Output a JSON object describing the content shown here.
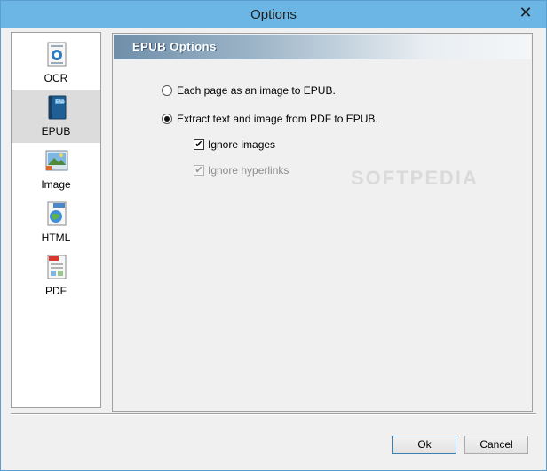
{
  "window": {
    "title": "Options",
    "close": "✕"
  },
  "nav": {
    "items": [
      {
        "label": "OCR",
        "icon": "ocr-icon"
      },
      {
        "label": "EPUB",
        "icon": "epub-book-icon",
        "selected": true
      },
      {
        "label": "Image",
        "icon": "image-icon"
      },
      {
        "label": "HTML",
        "icon": "html-icon"
      },
      {
        "label": "PDF",
        "icon": "pdf-icon"
      }
    ]
  },
  "pane": {
    "header": "EPUB Options",
    "options": {
      "radio1": "Each page as an image to EPUB.",
      "radio2": "Extract text and image from PDF to EPUB.",
      "check1": "Ignore images",
      "check2": "Ignore hyperlinks"
    },
    "state": {
      "radio1_checked": false,
      "radio2_checked": true,
      "check1_checked": true,
      "check2_checked": true,
      "check2_disabled": true
    },
    "watermark": "SOFTPEDIA"
  },
  "buttons": {
    "ok": "Ok",
    "cancel": "Cancel"
  },
  "colors": {
    "titlebar": "#6cb6e6",
    "selected_nav": "#dcdcdc",
    "header_gradient_start": "#6f8ea8"
  }
}
